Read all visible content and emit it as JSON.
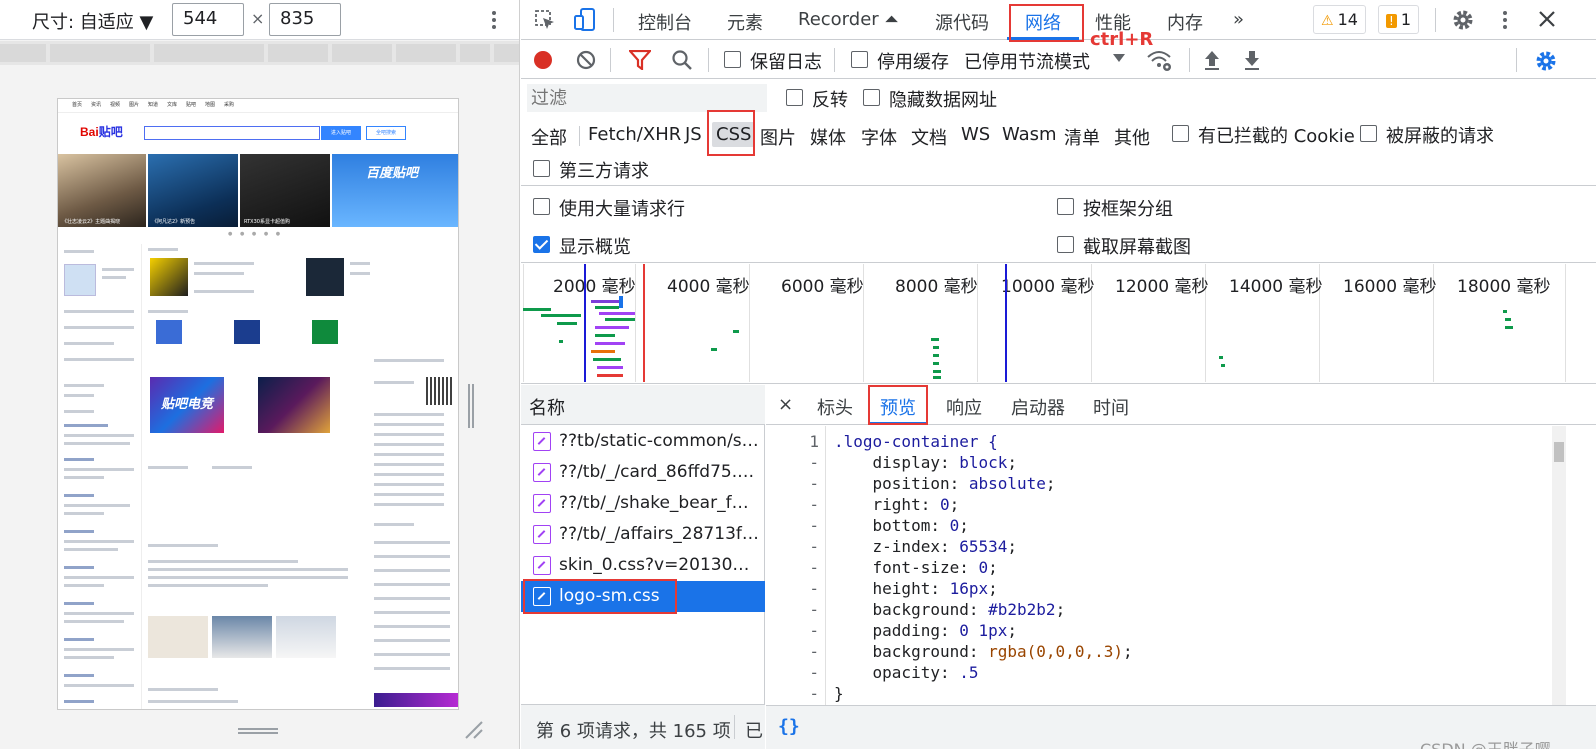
{
  "device_toolbar": {
    "size_label": "尺寸: 自适应 ▼",
    "width": "544",
    "height": "835",
    "times": "×"
  },
  "tieba": {
    "top_links": [
      "首页",
      "资讯",
      "视频",
      "图片",
      "知道",
      "文库",
      "贴吧",
      "地图",
      "采购"
    ],
    "logo": "Bai",
    "logo_paw": "贴吧",
    "enter_button": "进入贴吧",
    "search_all_button": "全吧搜索",
    "banners": [
      "《壮志凌云2》主题曲揭晓",
      "《阿凡达2》新预告",
      "RTX30系显卡超值购"
    ],
    "banner_tieba": "百度贴吧",
    "game_banner": "贴吧电竞"
  },
  "devtools": {
    "tabs": [
      "控制台",
      "元素",
      "Recorder ⏶",
      "源代码",
      "网络",
      "性能",
      "内存",
      "»"
    ],
    "active_tab": "网络",
    "warnings_count": "14",
    "issues_count": "1",
    "annotation_shortcut": "ctrl+R",
    "net_toolbar": {
      "preserve_log": "保留日志",
      "disable_cache": "停用缓存",
      "throttle": "已停用节流模式"
    },
    "filter_placeholder": "过滤",
    "filter_options": {
      "invert": "反转",
      "hide_data_urls": "隐藏数据网址"
    },
    "types": [
      "全部",
      "Fetch/XHR",
      "JS",
      "CSS",
      "图片",
      "媒体",
      "字体",
      "文档",
      "WS",
      "Wasm",
      "清单",
      "其他"
    ],
    "selected_type": "CSS",
    "blocked_cookies": "有已拦截的 Cookie",
    "blocked_requests": "被屏蔽的请求",
    "third_party": "第三方请求",
    "options": {
      "large_rows": "使用大量请求行",
      "group_by_frame": "按框架分组",
      "show_overview": "显示概览",
      "capture_screenshots": "截取屏幕截图"
    },
    "overview_ticks": [
      "2000 毫秒",
      "4000 毫秒",
      "6000 毫秒",
      "8000 毫秒",
      "10000 毫秒",
      "12000 毫秒",
      "14000 毫秒",
      "16000 毫秒",
      "18000 毫秒"
    ],
    "name_header": "名称",
    "requests": [
      "??tb/static-common/sty...",
      "??/tb/_/card_86ffd75.cs...",
      "??/tb/_/shake_bear_f57...",
      "??/tb/_/affairs_28713fe....",
      "skin_0.css?v=20130803",
      "logo-sm.css"
    ],
    "selected_request": "logo-sm.css",
    "status": "第 6 项请求，共 165 项",
    "status_cut": "已",
    "detail_tabs": [
      "标头",
      "预览",
      "响应",
      "启动器",
      "时间"
    ],
    "active_detail_tab": "预览",
    "close_glyph": "×",
    "gutter": [
      "1",
      "-",
      "-",
      "-",
      "-",
      "-",
      "-",
      "-",
      "-",
      "-",
      "-",
      "-",
      "-"
    ],
    "code": {
      "selector": ".logo-container {",
      "decls": [
        {
          "prop": "display",
          "val": "block"
        },
        {
          "prop": "position",
          "val": "absolute"
        },
        {
          "prop": "right",
          "val": "0"
        },
        {
          "prop": "bottom",
          "val": "0"
        },
        {
          "prop": "z-index",
          "val": "65534"
        },
        {
          "prop": "font-size",
          "val": "0"
        },
        {
          "prop": "height",
          "val": "16px"
        },
        {
          "prop": "background",
          "val": "#b2b2b2"
        },
        {
          "prop": "padding",
          "val": "0 1px"
        },
        {
          "prop": "background",
          "val": "rgba(0,0,0,.3)"
        },
        {
          "prop": "opacity",
          "val": ".5"
        }
      ],
      "close": "}"
    },
    "format_glyph": "{}"
  },
  "watermark": "CSDN @王胖子嘤",
  "colors": {
    "accent": "#1a73e8",
    "annotation_red": "#e53935",
    "record_red": "#d93025",
    "resource_css": "#a142f4"
  }
}
